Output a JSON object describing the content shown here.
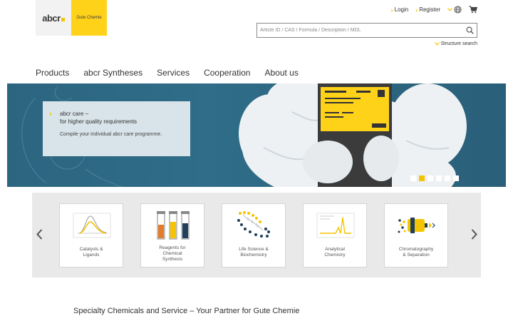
{
  "logo": {
    "word": "abcr",
    "tagline": "Gute Chemie"
  },
  "top_links": {
    "login": "Login",
    "register": "Register"
  },
  "search": {
    "placeholder": "Article ID / CAS / Formula / Description / MDL"
  },
  "structure_search": "Structure search",
  "nav": [
    "Products",
    "abcr Syntheses",
    "Services",
    "Cooperation",
    "About us"
  ],
  "hero": {
    "title_line1": "abcr care –",
    "title_line2": "for higher quality requirements",
    "subtitle": "Compile your individual abcr care programme.",
    "slide_count": 6,
    "active_slide": 2
  },
  "categories": [
    {
      "line1": "Catalysts &",
      "line2": "Ligands",
      "line3": "",
      "icon": "catalyst-chart-icon"
    },
    {
      "line1": "Reagents for",
      "line2": "Chemical",
      "line3": "Synthesis",
      "icon": "test-tubes-icon"
    },
    {
      "line1": "Life Science &",
      "line2": "Biochemistry",
      "line3": "",
      "icon": "dna-helix-icon"
    },
    {
      "line1": "Analytical",
      "line2": "Chemistry",
      "line3": "",
      "icon": "spectrum-peak-icon"
    },
    {
      "line1": "Chromatography",
      "line2": "& Separation",
      "line3": "",
      "icon": "chromatography-column-icon"
    }
  ],
  "tagline": "Specialty Chemicals and Service – Your Partner for Gute Chemie",
  "colors": {
    "brand_yellow": "#f5c400",
    "hero_blue": "#2f6d88",
    "card_bg": "#d9e4ea",
    "dark_blue": "#1f3f5a"
  }
}
